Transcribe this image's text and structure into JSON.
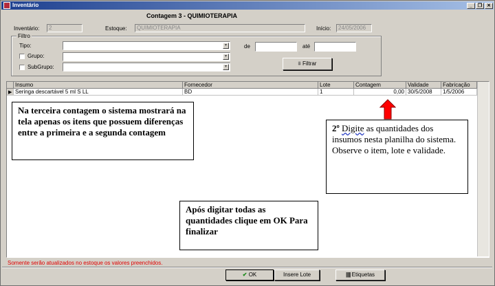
{
  "window": {
    "title": "Inventário",
    "minimize_label": "_",
    "restore_label": "❐",
    "close_label": "✕"
  },
  "header": {
    "heading": "Contagem 3 - QUIMIOTERAPIA",
    "inventario_label": "Inventário:",
    "inventario_value": "2",
    "estoque_label": "Estoque:",
    "estoque_value": "QUIMIOTERAPIA",
    "inicio_label": "Início:",
    "inicio_value": "24/05/2006"
  },
  "filter": {
    "legend": "Filtro",
    "tipo_label": "Tipo:",
    "grupo_label": "Grupo:",
    "subgrupo_label": "SubGrupo:",
    "de_label": "de",
    "ate_label": "até",
    "filtrar_label": "Filtrar"
  },
  "table": {
    "columns": [
      "Insumo",
      "Fornecedor",
      "Lote",
      "Contagem",
      "Validade",
      "Fabricação"
    ],
    "rows": [
      [
        "Seringa  descartável 5 ml S LL",
        "BD",
        "1",
        "0,00",
        "30/5/2008",
        "1/5/2006"
      ]
    ]
  },
  "callouts": {
    "left": "Na terceira contagem o sistema mostrará na tela apenas os itens que possuem diferenças entre a primeira e a segunda contagem",
    "right_number": "2º",
    "right_underlined": "Digite",
    "right_rest": " as quantidades dos insumos nesta planilha do sistema.",
    "right_line2": "Observe o item, lote e validade.",
    "bottom": "Após digitar todas as quantidades clique em OK Para finalizar"
  },
  "status_message": "Somente serão atualizados no estoque os valores preenchidos.",
  "buttons": {
    "ok": "OK",
    "insere_lote": "Insere Lote",
    "etiquetas": "Etiquetas"
  },
  "colors": {
    "window_bg": "#d4d0c8",
    "title_start": "#1d3f8f",
    "arrow_red": "#ff0000",
    "status_red": "#e00000"
  }
}
